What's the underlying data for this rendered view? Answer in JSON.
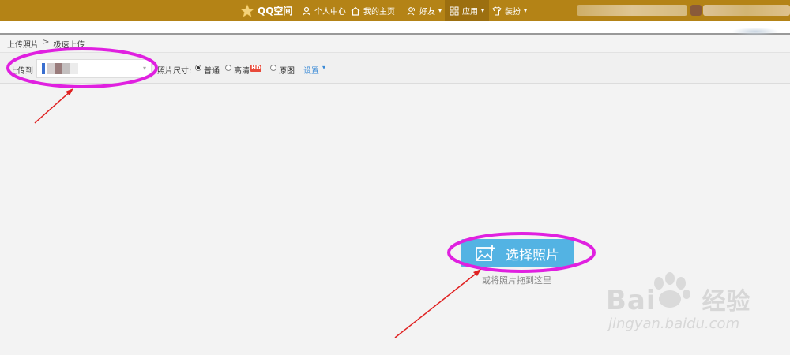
{
  "app": {
    "logo_text": "QQ空间"
  },
  "nav": [
    {
      "label": "个人中心",
      "icon": "person-icon"
    },
    {
      "label": "我的主页",
      "icon": "home-icon"
    },
    {
      "label": "好友",
      "icon": "friends-icon"
    },
    {
      "label": "应用",
      "icon": "apps-grid-icon"
    },
    {
      "label": "装扮",
      "icon": "shirt-icon"
    }
  ],
  "breadcrumb": {
    "parent": "上传照片",
    "separator": ">",
    "current": "极速上传"
  },
  "toolbar": {
    "upload_to_label": "上传到",
    "photo_size_label": "照片尺寸:",
    "size_options": [
      {
        "label": "普通",
        "selected": true
      },
      {
        "label": "高清",
        "selected": false,
        "badge": "HD"
      },
      {
        "label": "原图",
        "selected": false
      }
    ],
    "settings_label": "设置"
  },
  "main": {
    "select_button_label": "选择照片",
    "drop_hint": "或将照片拖到这里"
  },
  "watermark": {
    "brand": "Bai",
    "brand_tail": "经验",
    "url": "jingyan.baidu.com"
  },
  "colors": {
    "topbar": "#b48316",
    "accent_blue": "#53b3e3",
    "annotation_magenta": "#e020e0",
    "annotation_arrow": "#e02020"
  }
}
